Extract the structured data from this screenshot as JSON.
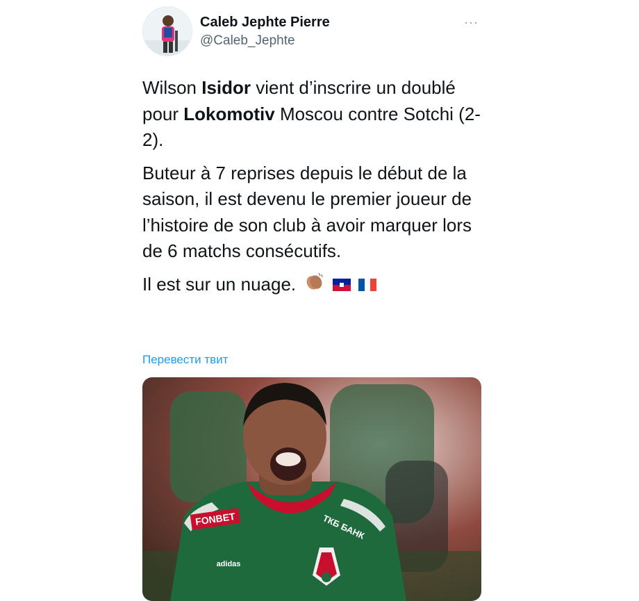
{
  "author": {
    "name": "Caleb Jephte Pierre",
    "handle": "@Caleb_Jephte"
  },
  "more_icon": "···",
  "tweet": {
    "p1": {
      "t1": "Wilson ",
      "b1": "Isidor",
      "t2": " vient d’inscrire un doublé pour ",
      "b2": "Lokomotiv",
      "t3": " Moscou contre Sotchi (2-2)."
    },
    "p2": "Buteur à 7 reprises depuis le début de la saison, il est devenu le premier joueur de l’histoire de son club à avoir marquer lors de 6 matchs consécutifs.",
    "p3": "Il est sur un nuage."
  },
  "translate_label": "Перевести твит",
  "media": {
    "jersey_sponsor": "FONBET",
    "jersey_sponsor2": "ТКБ БАНК",
    "jersey_brand": "adidas"
  },
  "colors": {
    "link": "#1d9bf0",
    "jersey_green": "#1e6a3c",
    "jersey_red": "#c8102e"
  },
  "icons": [
    "more-icon",
    "clapping-hands-icon",
    "haiti-flag-icon",
    "france-flag-icon"
  ]
}
